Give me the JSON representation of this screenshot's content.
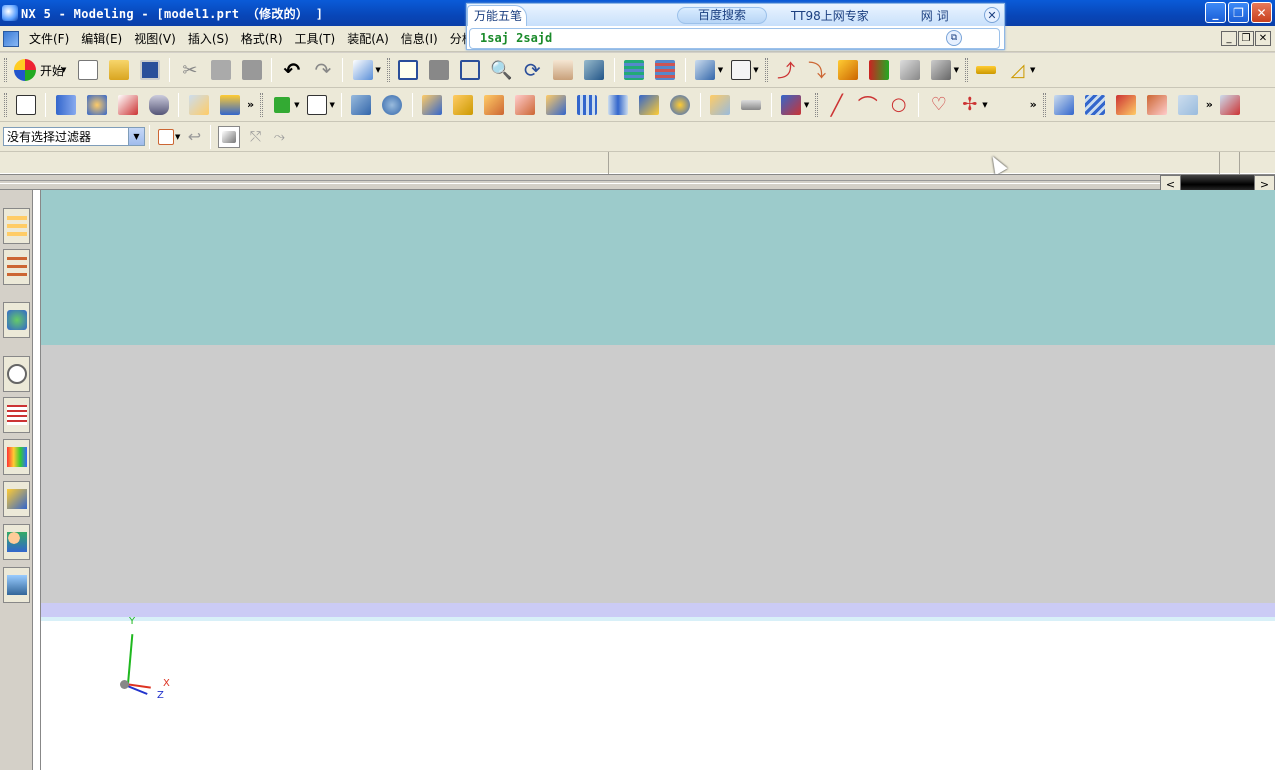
{
  "window": {
    "title": "NX 5 - Modeling - [model1.prt （修改的） ]"
  },
  "menubar": {
    "items": [
      "文件(F)",
      "编辑(E)",
      "视图(V)",
      "插入(S)",
      "格式(R)",
      "工具(T)",
      "装配(A)",
      "信息(I)",
      "分析(L)"
    ]
  },
  "ime": {
    "tabs": [
      "万能五笔",
      "百度搜索",
      "TT98上网专家",
      "网 词"
    ],
    "input_text": "1saj 2sajd"
  },
  "toolbar": {
    "start_label": "开始"
  },
  "selection": {
    "filter_value": "没有选择过滤器"
  },
  "triad": {
    "x": "X",
    "y": "Y",
    "z": "Z"
  },
  "colors": {
    "viewport_top": "#9ccbcb",
    "viewport_mid": "#cccccc",
    "viewport_band": "#cbcbf5",
    "titlebar": "#0a4fc8"
  }
}
